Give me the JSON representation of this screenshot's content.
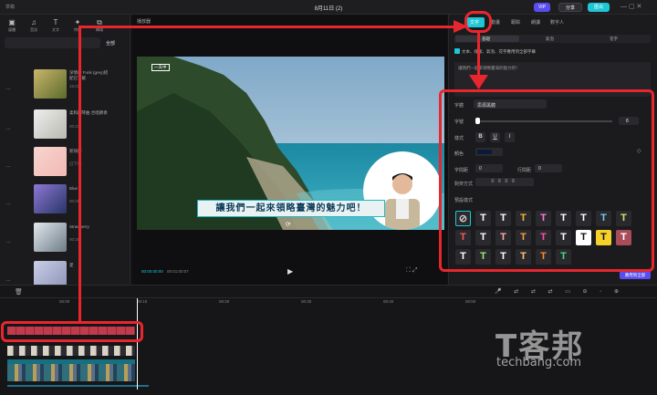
{
  "titlebar": {
    "title": "8月11日 (2)",
    "left_label": "草稿",
    "pro_label": "VIP",
    "share_label": "分享",
    "export_label": "匯出"
  },
  "left_tabs": [
    {
      "icon": "folder-icon",
      "label": "媒體"
    },
    {
      "icon": "audio-icon",
      "label": "音訊"
    },
    {
      "icon": "text-icon",
      "label": "文字"
    },
    {
      "icon": "effects-icon",
      "label": "特效"
    },
    {
      "icon": "transition-icon",
      "label": "轉場"
    }
  ],
  "left_panel": {
    "filter_label": "全部",
    "items": [
      {
        "title": "深情的 Funk (grey)搭配已下載",
        "sub": "15:02"
      },
      {
        "title": "柔和鋼琴曲 合唱節奏",
        "sub": "00:23"
      },
      {
        "title": "新快節",
        "sub": "已下載"
      },
      {
        "title": "Blue",
        "sub": "00:25"
      },
      {
        "title": "Strawberry",
        "sub": "00:30"
      },
      {
        "title": "愛",
        "sub": "00:28"
      }
    ],
    "left_snips": [
      "...",
      "...",
      "...",
      "...",
      "...",
      "..."
    ]
  },
  "player": {
    "header": "播放器",
    "chip": "一天中",
    "subtitle": "讓我們一起來領略臺灣的魅力吧！",
    "time_current": "00:00:00:00",
    "time_total": "00:01:00:07"
  },
  "right_panel": {
    "tabs": [
      "文字",
      "動畫",
      "跟踪",
      "朗讀",
      "數字人"
    ],
    "subtabs": [
      "基礎",
      "氣泡",
      "花字"
    ],
    "checkbox_label": "文本、排版、氣泡、花字應用到全部字幕",
    "text_content": "讓我們一起來領略臺灣的魅力吧！",
    "font_label": "字體",
    "font_value": "思源黑體",
    "size_label": "字號",
    "size_value": "8",
    "style_label": "樣式",
    "style_bold": "B",
    "style_underline": "U",
    "style_italic": "I",
    "color_label": "顏色",
    "spacing_label": "字間距",
    "spacing_value": "0",
    "line_label": "行間距",
    "line_value": "0",
    "align_label": "對齊方式",
    "preset_label": "預設樣式",
    "apply_button": "應用到全部",
    "presets": [
      {
        "glyph": "⊘",
        "fg": "#cccccc",
        "bg": "#2a2a2e"
      },
      {
        "glyph": "T",
        "fg": "#ffffff",
        "bg": "#2a2a2e"
      },
      {
        "glyph": "T",
        "fg": "#ffffff",
        "bg": "#2a2a2e"
      },
      {
        "glyph": "T",
        "fg": "#f5b638",
        "bg": "#2a2a2e"
      },
      {
        "glyph": "T",
        "fg": "#ff7bd4",
        "bg": "#2a2a2e"
      },
      {
        "glyph": "T",
        "fg": "#ffffff",
        "bg": "#2a2a2e"
      },
      {
        "glyph": "T",
        "fg": "#ffffff",
        "bg": "#2a2a2e"
      },
      {
        "glyph": "T",
        "fg": "#72c9f7",
        "bg": "#2a2a2e"
      },
      {
        "glyph": "T",
        "fg": "#c7e86c",
        "bg": "#2a2a2e"
      },
      {
        "glyph": "T",
        "fg": "#f05a5a",
        "bg": "#2a2a2e"
      },
      {
        "glyph": "T",
        "fg": "#ffffff",
        "bg": "#2a2a2e"
      },
      {
        "glyph": "T",
        "fg": "#ffa9a9",
        "bg": "#2a2a2e"
      },
      {
        "glyph": "T",
        "fg": "#f0a040",
        "bg": "#2a2a2e"
      },
      {
        "glyph": "T",
        "fg": "#ff4fa8",
        "bg": "#2a2a2e"
      },
      {
        "glyph": "T",
        "fg": "#ffffff",
        "bg": "#2a2a2e"
      },
      {
        "glyph": "T",
        "fg": "#111111",
        "bg": "#ffffff"
      },
      {
        "glyph": "T",
        "fg": "#111111",
        "bg": "#f5d22a"
      },
      {
        "glyph": "T",
        "fg": "#ffffff",
        "bg": "#a84c5a"
      },
      {
        "glyph": "T",
        "fg": "#ffffff",
        "bg": "#2a2a2e"
      },
      {
        "glyph": "T",
        "fg": "#9fe870",
        "bg": "#2a2a2e"
      },
      {
        "glyph": "T",
        "fg": "#ffffff",
        "bg": "#2a2a2e"
      },
      {
        "glyph": "T",
        "fg": "#ffc078",
        "bg": "#2a2a2e"
      },
      {
        "glyph": "T",
        "fg": "#ff8c28",
        "bg": "#2a2a2e"
      },
      {
        "glyph": "T",
        "fg": "#3fe07a",
        "bg": "#2a2a2e"
      }
    ]
  },
  "timeline": {
    "ticks": [
      "00:00",
      "00:10",
      "00:20",
      "00:30",
      "00:40",
      "00:50"
    ]
  },
  "watermark": {
    "main": "T客邦",
    "url": "techbang.com"
  },
  "colors": {
    "accent": "#1fc6d6",
    "highlight": "#e8262d"
  }
}
